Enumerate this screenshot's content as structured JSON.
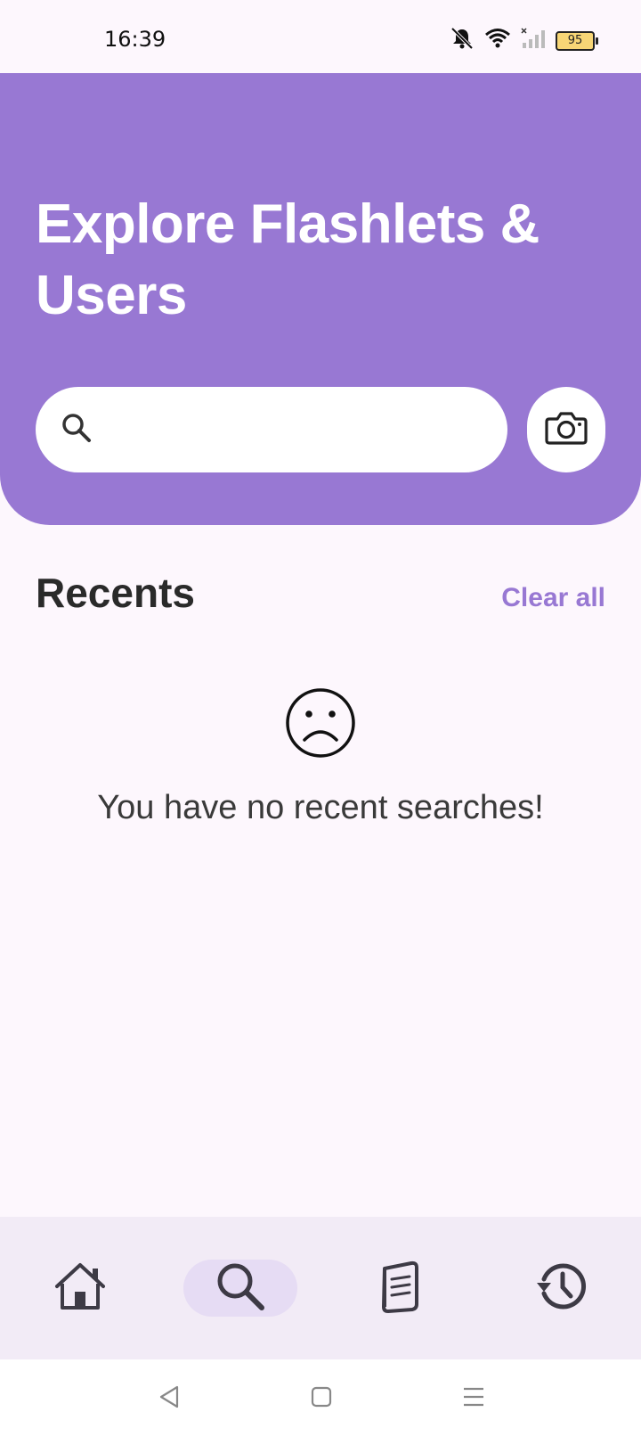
{
  "status_bar": {
    "time": "16:39",
    "battery_level": "95",
    "icons": [
      "mute-icon",
      "wifi-icon",
      "signal-icon",
      "battery-icon"
    ]
  },
  "header": {
    "title": "Explore Flashlets & Users",
    "search": {
      "placeholder": "",
      "value": ""
    },
    "camera_icon": "camera-icon"
  },
  "recents": {
    "title": "Recents",
    "clear_label": "Clear all",
    "empty_icon": "sad-face-icon",
    "empty_message": "You have no recent searches!"
  },
  "bottom_nav": {
    "items": [
      {
        "name": "home",
        "icon": "home-icon",
        "active": false
      },
      {
        "name": "search",
        "icon": "search-icon",
        "active": true
      },
      {
        "name": "library",
        "icon": "book-icon",
        "active": false
      },
      {
        "name": "history",
        "icon": "history-icon",
        "active": false
      }
    ]
  },
  "system_nav": {
    "items": [
      "back-icon",
      "home-square-icon",
      "menu-icon"
    ]
  },
  "colors": {
    "accent": "#9878d3",
    "background": "#fdf7fd",
    "nav_background": "#f2ebf6",
    "nav_active": "#e6dcf4",
    "text_dark": "#2a2a2a"
  }
}
